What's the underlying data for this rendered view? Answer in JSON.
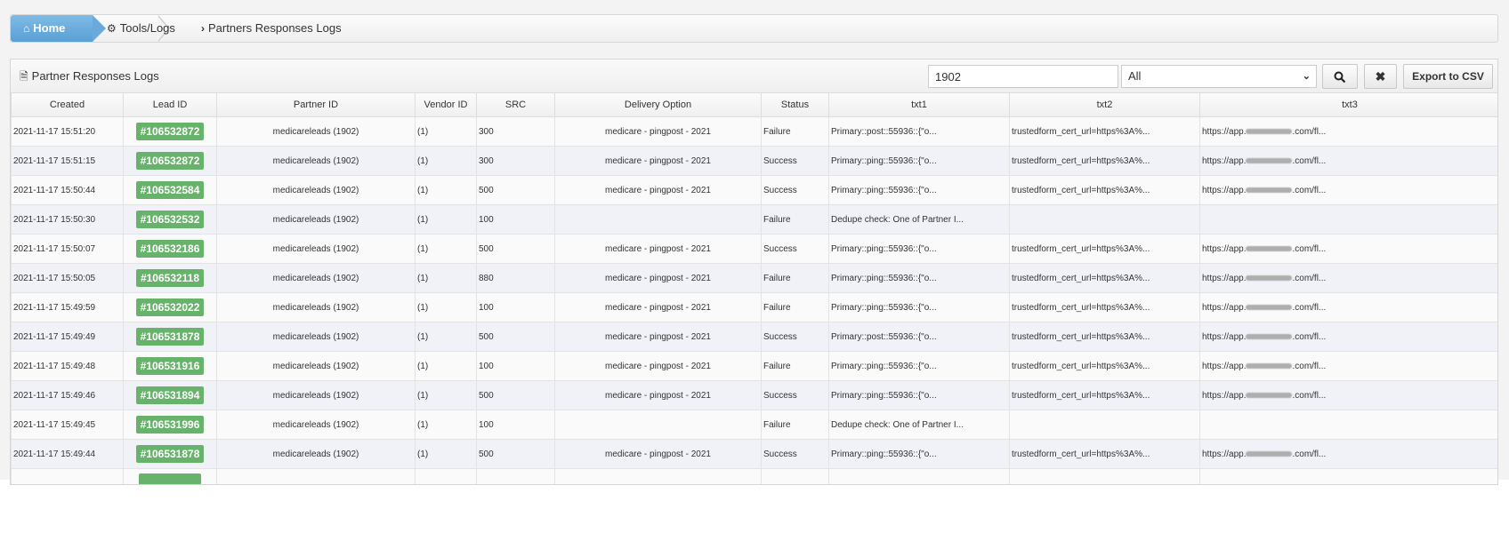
{
  "breadcrumb": {
    "home_label": "Home",
    "tools_label": "Tools/Logs",
    "current_label": "Partners Responses Logs"
  },
  "panel": {
    "title": "Partner Responses Logs",
    "search_value": "1902",
    "select_value": "All",
    "export_label": "Export to CSV"
  },
  "table": {
    "columns": [
      "Created",
      "Lead ID",
      "Partner ID",
      "Vendor ID",
      "SRC",
      "Delivery Option",
      "Status",
      "txt1",
      "txt2",
      "txt3"
    ],
    "rows": [
      {
        "created": "2021-11-17 15:51:20",
        "lead_id": "#106532872",
        "partner_id": "medicareleads (1902)",
        "vendor_id": "(1)",
        "src": "300",
        "delivery": "medicare - pingpost - 2021",
        "status": "Failure",
        "txt1": "Primary::post::55936::{\"o...",
        "txt2": "trustedform_cert_url=https%3A%...",
        "txt3_a": "https://app.",
        "txt3_b": ".com/fl..."
      },
      {
        "created": "2021-11-17 15:51:15",
        "lead_id": "#106532872",
        "partner_id": "medicareleads (1902)",
        "vendor_id": "(1)",
        "src": "300",
        "delivery": "medicare - pingpost - 2021",
        "status": "Success",
        "txt1": "Primary::ping::55936::{\"o...",
        "txt2": "trustedform_cert_url=https%3A%...",
        "txt3_a": "https://app.",
        "txt3_b": ".com/fl..."
      },
      {
        "created": "2021-11-17 15:50:44",
        "lead_id": "#106532584",
        "partner_id": "medicareleads (1902)",
        "vendor_id": "(1)",
        "src": "500",
        "delivery": "medicare - pingpost - 2021",
        "status": "Success",
        "txt1": "Primary::ping::55936::{\"o...",
        "txt2": "trustedform_cert_url=https%3A%...",
        "txt3_a": "https://app.",
        "txt3_b": ".com/fl..."
      },
      {
        "created": "2021-11-17 15:50:30",
        "lead_id": "#106532532",
        "partner_id": "medicareleads (1902)",
        "vendor_id": "(1)",
        "src": "100",
        "delivery": "",
        "status": "Failure",
        "txt1": "Dedupe check: One of Partner I...",
        "txt2": "",
        "txt3_a": "",
        "txt3_b": ""
      },
      {
        "created": "2021-11-17 15:50:07",
        "lead_id": "#106532186",
        "partner_id": "medicareleads (1902)",
        "vendor_id": "(1)",
        "src": "500",
        "delivery": "medicare - pingpost - 2021",
        "status": "Success",
        "txt1": "Primary::ping::55936::{\"o...",
        "txt2": "trustedform_cert_url=https%3A%...",
        "txt3_a": "https://app.",
        "txt3_b": ".com/fl..."
      },
      {
        "created": "2021-11-17 15:50:05",
        "lead_id": "#106532118",
        "partner_id": "medicareleads (1902)",
        "vendor_id": "(1)",
        "src": "880",
        "delivery": "medicare - pingpost - 2021",
        "status": "Failure",
        "txt1": "Primary::ping::55936::{\"o...",
        "txt2": "trustedform_cert_url=https%3A%...",
        "txt3_a": "https://app.",
        "txt3_b": ".com/fl..."
      },
      {
        "created": "2021-11-17 15:49:59",
        "lead_id": "#106532022",
        "partner_id": "medicareleads (1902)",
        "vendor_id": "(1)",
        "src": "100",
        "delivery": "medicare - pingpost - 2021",
        "status": "Failure",
        "txt1": "Primary::ping::55936::{\"o...",
        "txt2": "trustedform_cert_url=https%3A%...",
        "txt3_a": "https://app.",
        "txt3_b": ".com/fl..."
      },
      {
        "created": "2021-11-17 15:49:49",
        "lead_id": "#106531878",
        "partner_id": "medicareleads (1902)",
        "vendor_id": "(1)",
        "src": "500",
        "delivery": "medicare - pingpost - 2021",
        "status": "Success",
        "txt1": "Primary::post::55936::{\"o...",
        "txt2": "trustedform_cert_url=https%3A%...",
        "txt3_a": "https://app.",
        "txt3_b": ".com/fl..."
      },
      {
        "created": "2021-11-17 15:49:48",
        "lead_id": "#106531916",
        "partner_id": "medicareleads (1902)",
        "vendor_id": "(1)",
        "src": "100",
        "delivery": "medicare - pingpost - 2021",
        "status": "Failure",
        "txt1": "Primary::ping::55936::{\"o...",
        "txt2": "trustedform_cert_url=https%3A%...",
        "txt3_a": "https://app.",
        "txt3_b": ".com/fl..."
      },
      {
        "created": "2021-11-17 15:49:46",
        "lead_id": "#106531894",
        "partner_id": "medicareleads (1902)",
        "vendor_id": "(1)",
        "src": "500",
        "delivery": "medicare - pingpost - 2021",
        "status": "Success",
        "txt1": "Primary::ping::55936::{\"o...",
        "txt2": "trustedform_cert_url=https%3A%...",
        "txt3_a": "https://app.",
        "txt3_b": ".com/fl..."
      },
      {
        "created": "2021-11-17 15:49:45",
        "lead_id": "#106531996",
        "partner_id": "medicareleads (1902)",
        "vendor_id": "(1)",
        "src": "100",
        "delivery": "",
        "status": "Failure",
        "txt1": "Dedupe check: One of Partner I...",
        "txt2": "",
        "txt3_a": "",
        "txt3_b": ""
      },
      {
        "created": "2021-11-17 15:49:44",
        "lead_id": "#106531878",
        "partner_id": "medicareleads (1902)",
        "vendor_id": "(1)",
        "src": "500",
        "delivery": "medicare - pingpost - 2021",
        "status": "Success",
        "txt1": "Primary::ping::55936::{\"o...",
        "txt2": "trustedform_cert_url=https%3A%...",
        "txt3_a": "https://app.",
        "txt3_b": ".com/fl..."
      },
      {
        "created": "",
        "lead_id": "",
        "partner_id": "",
        "vendor_id": "",
        "src": "",
        "delivery": "",
        "status": "",
        "txt1": "",
        "txt2": "",
        "txt3_a": "",
        "txt3_b": ""
      }
    ]
  },
  "icons": {
    "home": "home-icon",
    "gear": "gear-icon",
    "chevron": "chevron-right-icon",
    "document": "document-icon",
    "search": "search-icon",
    "close": "close-icon"
  },
  "colors": {
    "home_blue": "#5a9fd4",
    "badge_green": "#68b36b"
  }
}
